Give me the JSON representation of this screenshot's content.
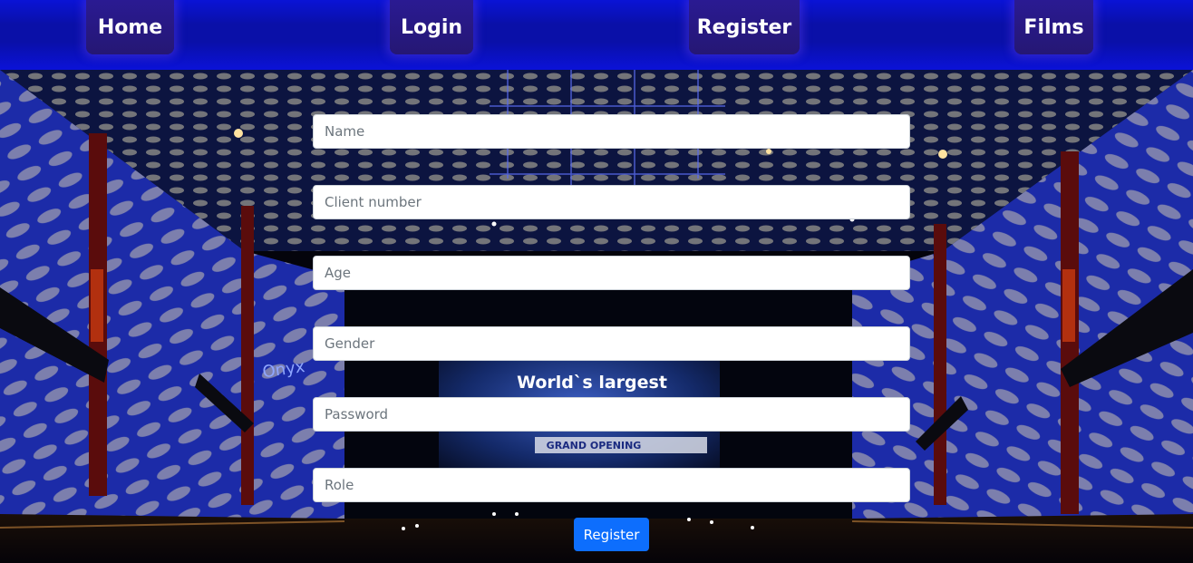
{
  "nav": {
    "home": "Home",
    "login": "Login",
    "register": "Register",
    "films": "Films"
  },
  "background": {
    "screen_text": "World`s largest",
    "screen_banner": "GRAND OPENING",
    "wall_logo": "Onyx"
  },
  "form": {
    "name_placeholder": "Name",
    "client_number_placeholder": "Client number",
    "age_placeholder": "Age",
    "gender_placeholder": "Gender",
    "password_placeholder": "Password",
    "role_placeholder": "Role",
    "submit_label": "Register"
  },
  "colors": {
    "nav_bar": "#0a13d6",
    "nav_button": "#2a1a92",
    "submit_button": "#0d6efd"
  }
}
